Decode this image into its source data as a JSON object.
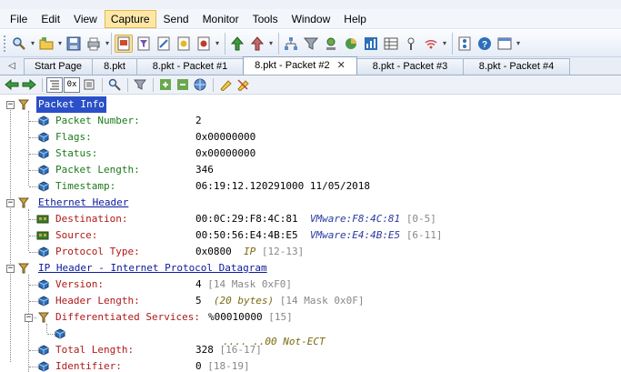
{
  "menu": {
    "items": [
      "File",
      "Edit",
      "View",
      "Capture",
      "Send",
      "Monitor",
      "Tools",
      "Window",
      "Help"
    ],
    "active": "Capture"
  },
  "tabs": [
    {
      "label": "Start Page",
      "active": false
    },
    {
      "label": "8.pkt",
      "active": false
    },
    {
      "label": "8.pkt - Packet #1",
      "active": false
    },
    {
      "label": "8.pkt - Packet #2",
      "active": true,
      "close": "✕"
    },
    {
      "label": "8.pkt - Packet #3",
      "active": false
    },
    {
      "label": "8.pkt - Packet #4",
      "active": false
    }
  ],
  "tab_nav_left": "◁",
  "subtoolbar": {
    "hex_label": "0x"
  },
  "tree": {
    "packet_info": {
      "header": "Packet Info",
      "fields": [
        {
          "name": "Packet Number:",
          "value": "2"
        },
        {
          "name": "Flags:",
          "value": "0x00000000"
        },
        {
          "name": "Status:",
          "value": "0x00000000"
        },
        {
          "name": "Packet Length:",
          "value": "346"
        },
        {
          "name": "Timestamp:",
          "value": "06:19:12.120291000 11/05/2018"
        }
      ]
    },
    "ethernet": {
      "header": "Ethernet Header",
      "fields": [
        {
          "name": "Destination:",
          "value": "00:0C:29:F8:4C:81",
          "extra": "VMware:F8:4C:81",
          "range": "[0-5]"
        },
        {
          "name": "Source:",
          "value": "00:50:56:E4:4B:E5",
          "extra": "VMware:E4:4B:E5",
          "range": "[6-11]"
        },
        {
          "name": "Protocol Type:",
          "value": "0x0800",
          "extra": "IP",
          "range": "[12-13]"
        }
      ]
    },
    "ip": {
      "header": "IP Header - Internet Protocol Datagram",
      "fields": [
        {
          "name": "Version:",
          "value": "4",
          "range": "[14 Mask 0xF0]"
        },
        {
          "name": "Header Length:",
          "value": "5",
          "extra": "(20 bytes)",
          "range": "[14 Mask 0x0F]"
        },
        {
          "name": "Differentiated Services:",
          "value": "%00010000",
          "range": "[15]"
        },
        {
          "name": "",
          "value": ".... ..00 Not-ECT"
        },
        {
          "name": "Total Length:",
          "value": "328",
          "range": "[16-17]"
        },
        {
          "name": "Identifier:",
          "value": "0",
          "range": "[18-19]"
        }
      ]
    }
  },
  "colors": {
    "selection": "#2a4fc8",
    "field_green": "#1b7a1b",
    "field_red": "#b01818",
    "header_blue": "#0a1a9c"
  }
}
